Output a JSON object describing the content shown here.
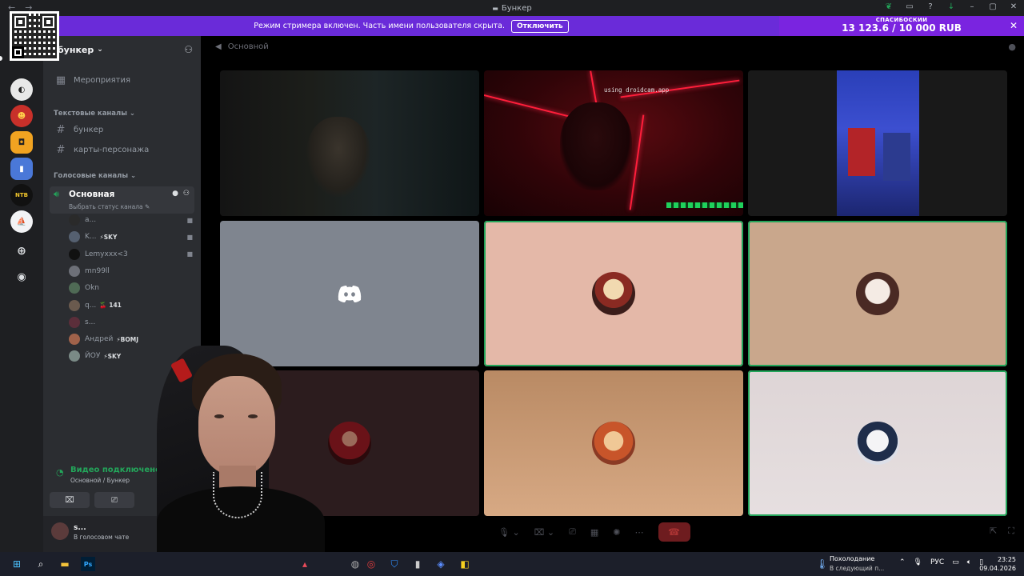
{
  "window": {
    "title": "Бункер"
  },
  "streamer_banner": {
    "text": "Режим стримера включен. Часть имени пользователя скрыта.",
    "button": "Отключить"
  },
  "donation": {
    "label": "СПАСИБОСКИИ",
    "amount": "13 123.6 / 10 000 RUB"
  },
  "server": {
    "name": "бункер",
    "events_label": "Мероприятия"
  },
  "categories": {
    "text": "Текстовые каналы",
    "voice": "Голосовые каналы"
  },
  "text_channels": [
    "бункер",
    "карты-персонажа"
  ],
  "voice_channel": {
    "name": "Основная",
    "status_placeholder": "Выбрать статус канала"
  },
  "members": [
    {
      "name": "a...",
      "tag": "",
      "camera": true,
      "avatar_color": "#2a2a2a"
    },
    {
      "name": "K...",
      "tag": "⚡SKY",
      "camera": true,
      "avatar_color": "#556070"
    },
    {
      "name": "Lemyxxx<3",
      "tag": "",
      "camera": true,
      "avatar_color": "#111111"
    },
    {
      "name": "mn99ll",
      "tag": "",
      "camera": false,
      "avatar_color": "#6d7078"
    },
    {
      "name": "Okn",
      "tag": "",
      "camera": false,
      "avatar_color": "#4f6a55"
    },
    {
      "name": "q...",
      "tag": "🍒 141",
      "camera": false,
      "avatar_color": "#6a5a4e"
    },
    {
      "name": "s...",
      "tag": "",
      "camera": false,
      "avatar_color": "#5b2e3a"
    },
    {
      "name": "Андрей",
      "tag": "⚡BOMJ",
      "camera": false,
      "avatar_color": "#a0624a"
    },
    {
      "name": "ЙОУ",
      "tag": "⚡SKY",
      "camera": false,
      "avatar_color": "#7a8a86"
    }
  ],
  "voice_connection": {
    "status": "Видео подключено",
    "location": "Основной / Бункер"
  },
  "user_panel": {
    "name": "s...",
    "status": "В голосовом чате"
  },
  "main": {
    "channel_name": "Основной"
  },
  "video_tiles": {
    "watermark": "using droidcam.app"
  },
  "taskbar": {
    "weather_title": "Похолодание",
    "weather_sub": "В следующий п...",
    "language": "РУС",
    "time": "23:25",
    "date": "09.04.2026"
  },
  "colors": {
    "banner": "#6a2bd9",
    "speaking": "#23a55a",
    "sidebar": "#2b2d31",
    "rail": "#1e1f22"
  }
}
